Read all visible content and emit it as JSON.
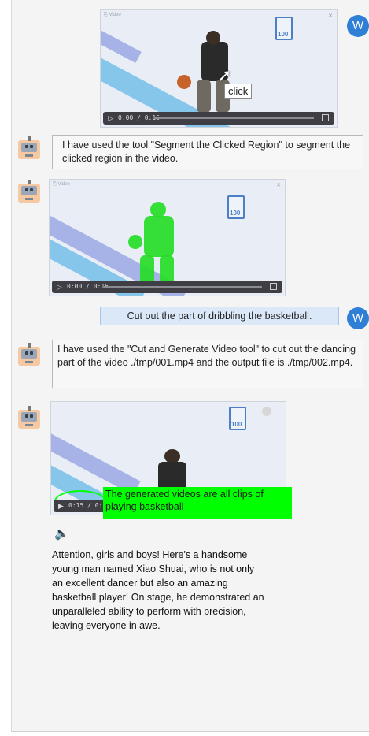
{
  "user_avatar_letter": "W",
  "video1": {
    "tag": "⎘ Video",
    "time": "0:00 / 0:16",
    "click_label": "click",
    "logo_text": "100"
  },
  "bot_msg1": "I have used the tool \"Segment the Clicked Region\" to segment the clicked region in the video.",
  "video2": {
    "tag": "⎘ Video",
    "time": "0:00 / 0:16",
    "logo_text": "100"
  },
  "user_msg2": "Cut out the part of dribbling the basketball.",
  "bot_msg2": "I have used the \"Cut and Generate Video tool\" to cut out the dancing part of the video ./tmp/001.mp4 and the output file is ./tmp/002.mp4.",
  "video3": {
    "time": "0:15 / 0:15",
    "logo_text": "100",
    "caption": "The generated videos are all clips of playing basketball"
  },
  "narration": "Attention, girls and boys! Here's a handsome young man named Xiao Shuai, who is not only an excellent dancer but also an amazing basketball player! On stage, he demonstrated an unparalleled ability to perform with precision, leaving everyone in awe.",
  "colors": {
    "user_avatar": "#2f7fd6",
    "segment_mask": "#22dd22",
    "caption_bg": "#00ff00"
  }
}
